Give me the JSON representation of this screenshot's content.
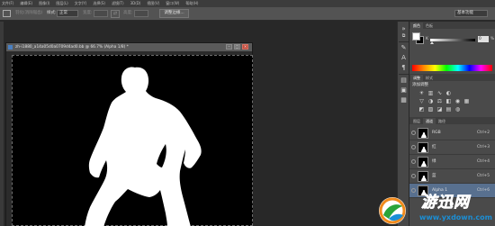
{
  "menu": [
    "文件(F)",
    "编辑(E)",
    "图像(I)",
    "图层(L)",
    "文字(Y)",
    "选择(S)",
    "滤镜(T)",
    "3D(D)",
    "视图(V)",
    "窗口(W)",
    "帮助(H)"
  ],
  "options": {
    "feather_label": "羽化(消除锯齿)",
    "style_label": "样式:",
    "style_value": "正常",
    "width_label": "宽度:",
    "height_label": "高度:",
    "refine_edge_button": "调整边缘...",
    "workspace_value": "基本功能"
  },
  "document": {
    "title": "zh-i1880_a14a05d0a0709d4ad0.bb @ 66.7% (Alpha 1/8) *"
  },
  "color_panel": {
    "tabs": [
      "颜色",
      "色板"
    ],
    "k_label": "K",
    "k_value": "0",
    "k_unit": "%"
  },
  "adjustments_panel": {
    "tabs": [
      "调整",
      "样式"
    ],
    "title": "添加调整",
    "icons": [
      [
        "brightness-icon",
        "levels-icon",
        "curves-icon",
        "exposure-icon"
      ],
      [
        "vibrance-icon",
        "hue-saturation-icon",
        "color-balance-icon",
        "black-white-icon",
        "photo-filter-icon",
        "channel-mixer-icon"
      ],
      [
        "invert-icon",
        "posterize-icon",
        "threshold-icon",
        "gradient-map-icon",
        "selective-color-icon"
      ]
    ]
  },
  "channels_panel": {
    "tabs": [
      "图层",
      "通道",
      "路径"
    ],
    "channels": [
      {
        "name": "RGB",
        "shortcut": "Ctrl+2",
        "selected": false
      },
      {
        "name": "红",
        "shortcut": "Ctrl+3",
        "selected": false
      },
      {
        "name": "绿",
        "shortcut": "Ctrl+4",
        "selected": false
      },
      {
        "name": "蓝",
        "shortcut": "Ctrl+5",
        "selected": false
      },
      {
        "name": "Alpha 1",
        "shortcut": "Ctrl+6",
        "selected": true
      }
    ]
  },
  "watermark": {
    "title": "游迅网",
    "url": "www.yxdown.com"
  }
}
